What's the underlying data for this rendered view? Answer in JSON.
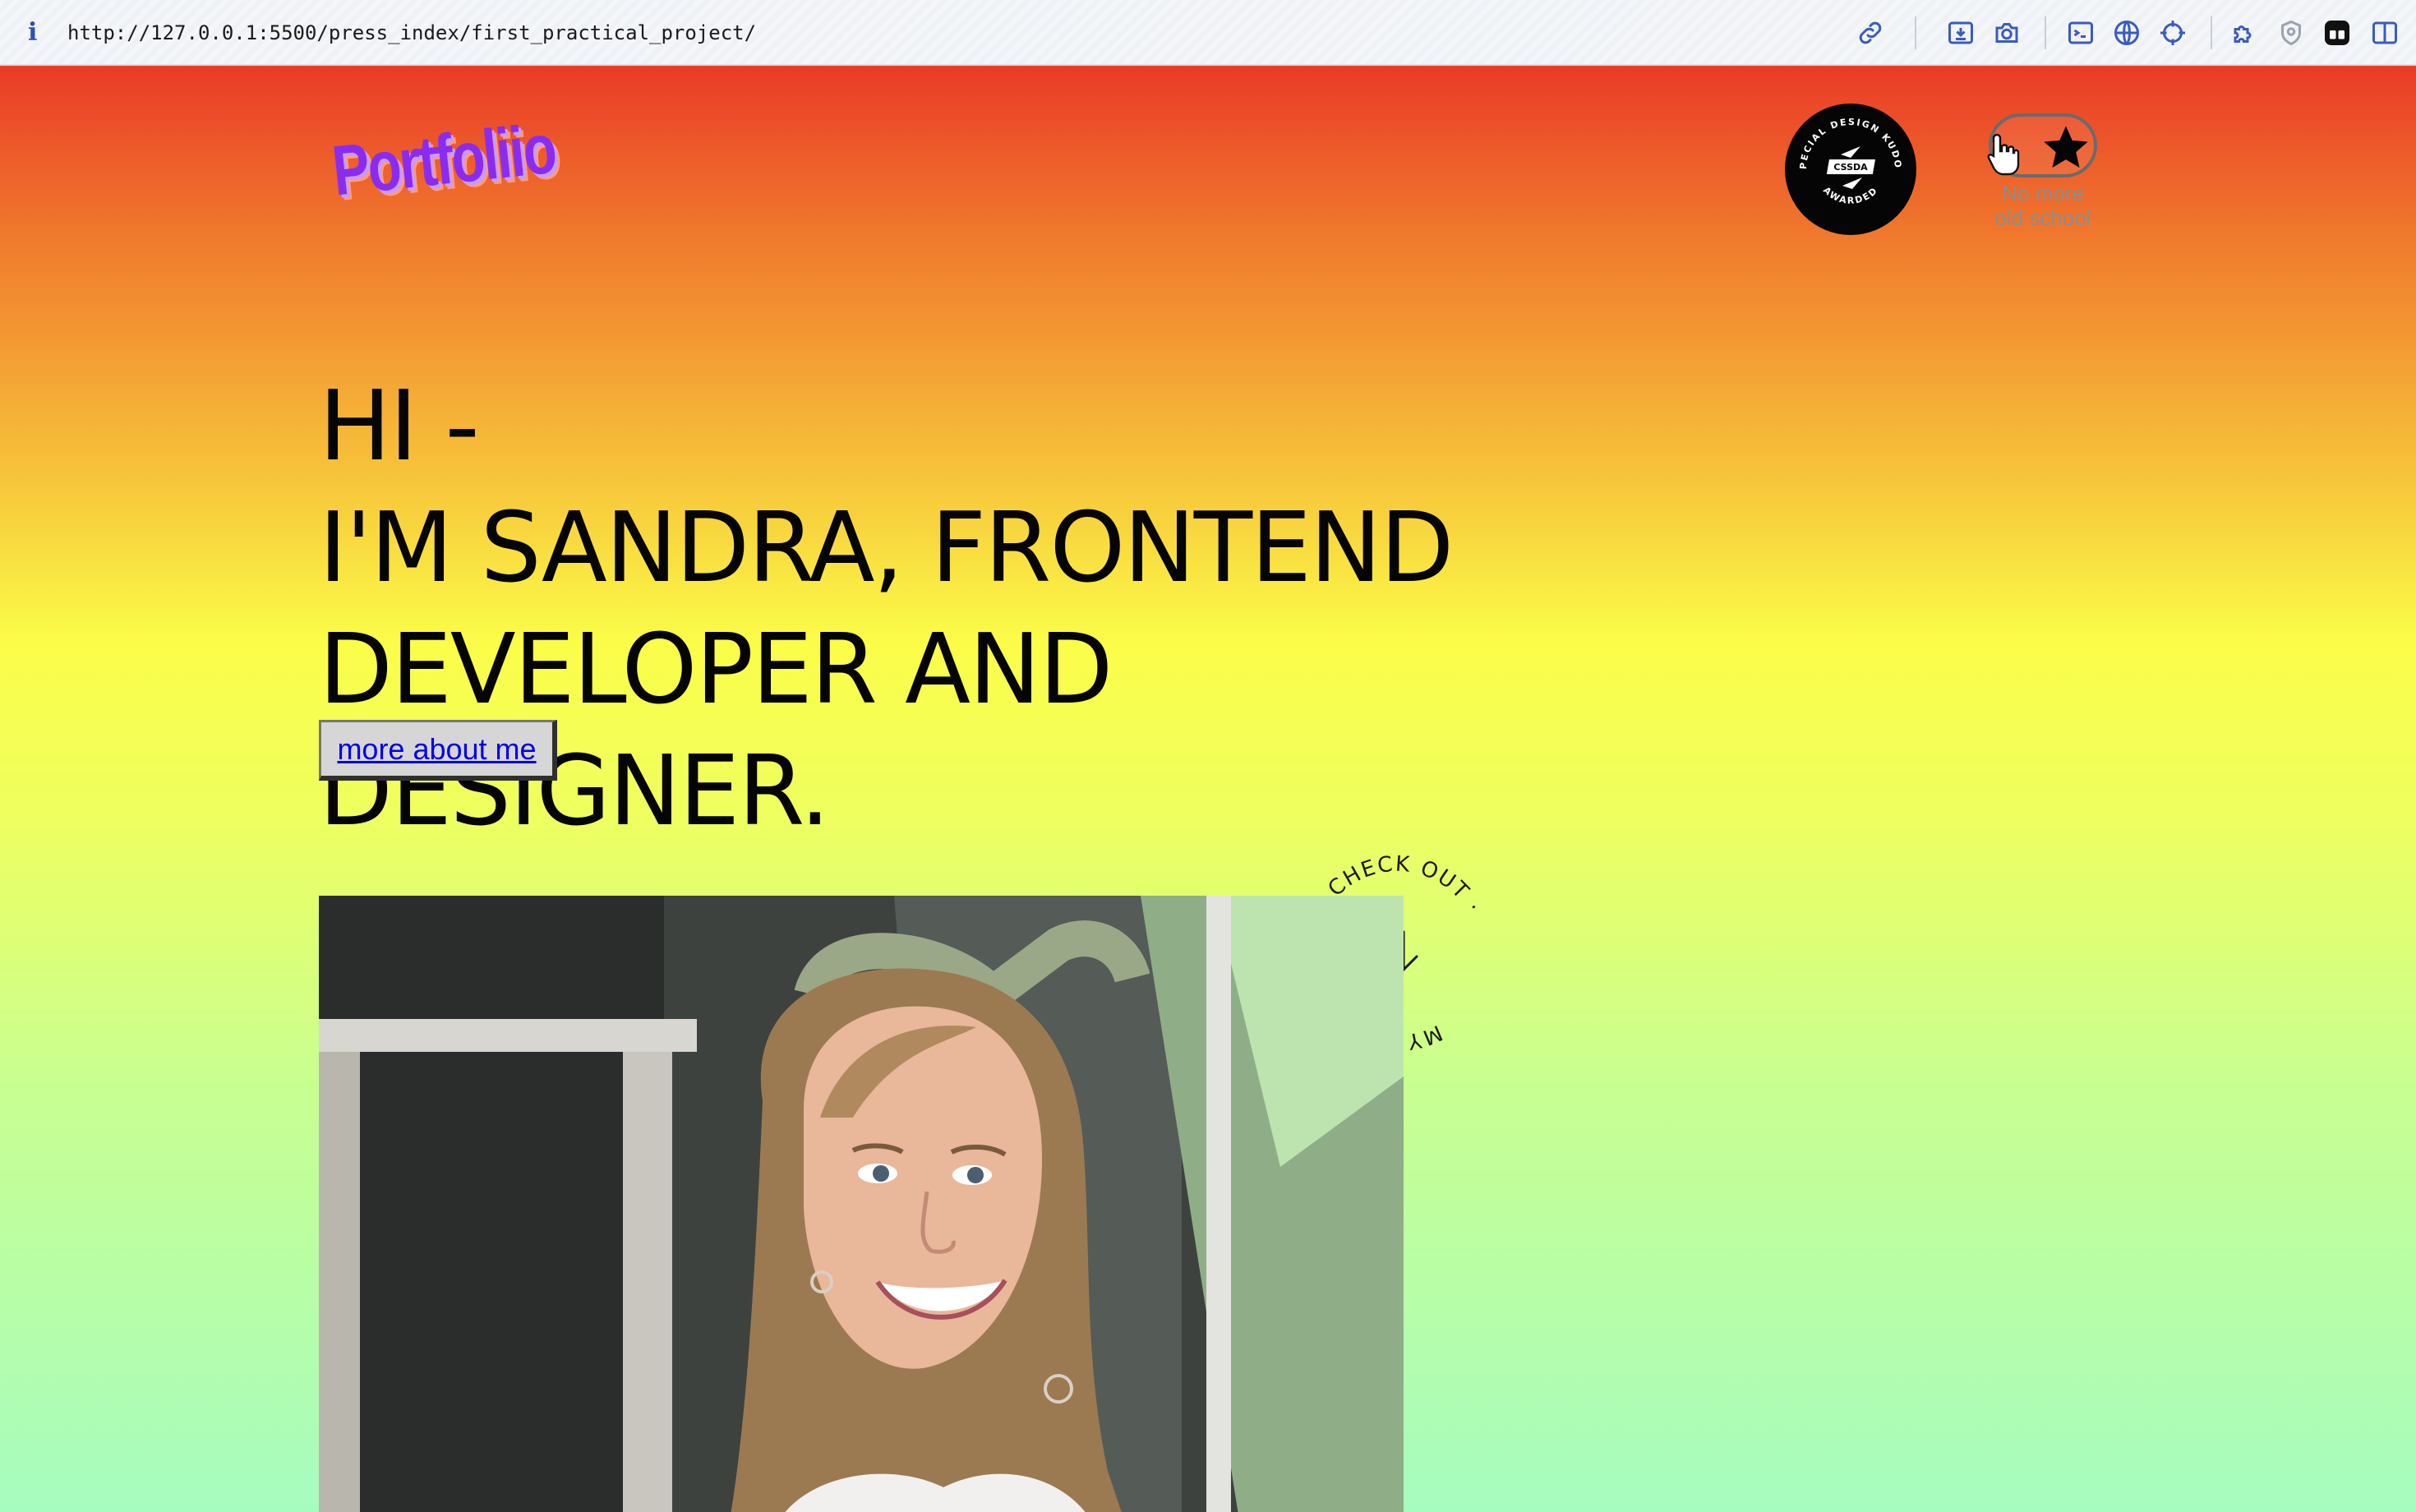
{
  "browser": {
    "url": "http://127.0.0.1:5500/press_index/first_practical_project/",
    "info_glyph": "i",
    "toolbar_icons": [
      "link-icon",
      "download-icon",
      "camera-icon",
      "terminal-icon",
      "globe-icon",
      "crosshair-icon",
      "puzzle-icon",
      "shield-icon",
      "tab-icon",
      "sidebar-icon"
    ]
  },
  "header": {
    "logo": "Portfoliio",
    "badge": {
      "top_text": "SPECIAL DESIGN KUDOS",
      "center_text": "CSSDA",
      "bottom_text": "AWARDED"
    },
    "toggle_caption_line1": "No more",
    "toggle_caption_line2": "old school"
  },
  "hero": {
    "line1": "HI -",
    "line2": "I'M SANDRA, FRONTEND",
    "line3": "DEVELOPER AND DESIGNER.",
    "button_label": "more about me"
  },
  "projects_link": {
    "circle_text": "MY PROJECTS · GO CHECK OUT ·"
  },
  "colors": {
    "gradient_top": "#ea3b27",
    "gradient_mid": "#fbfd48",
    "gradient_bottom": "#a6fcbf",
    "logo": "#8a2cf0",
    "link": "#0000ee"
  }
}
